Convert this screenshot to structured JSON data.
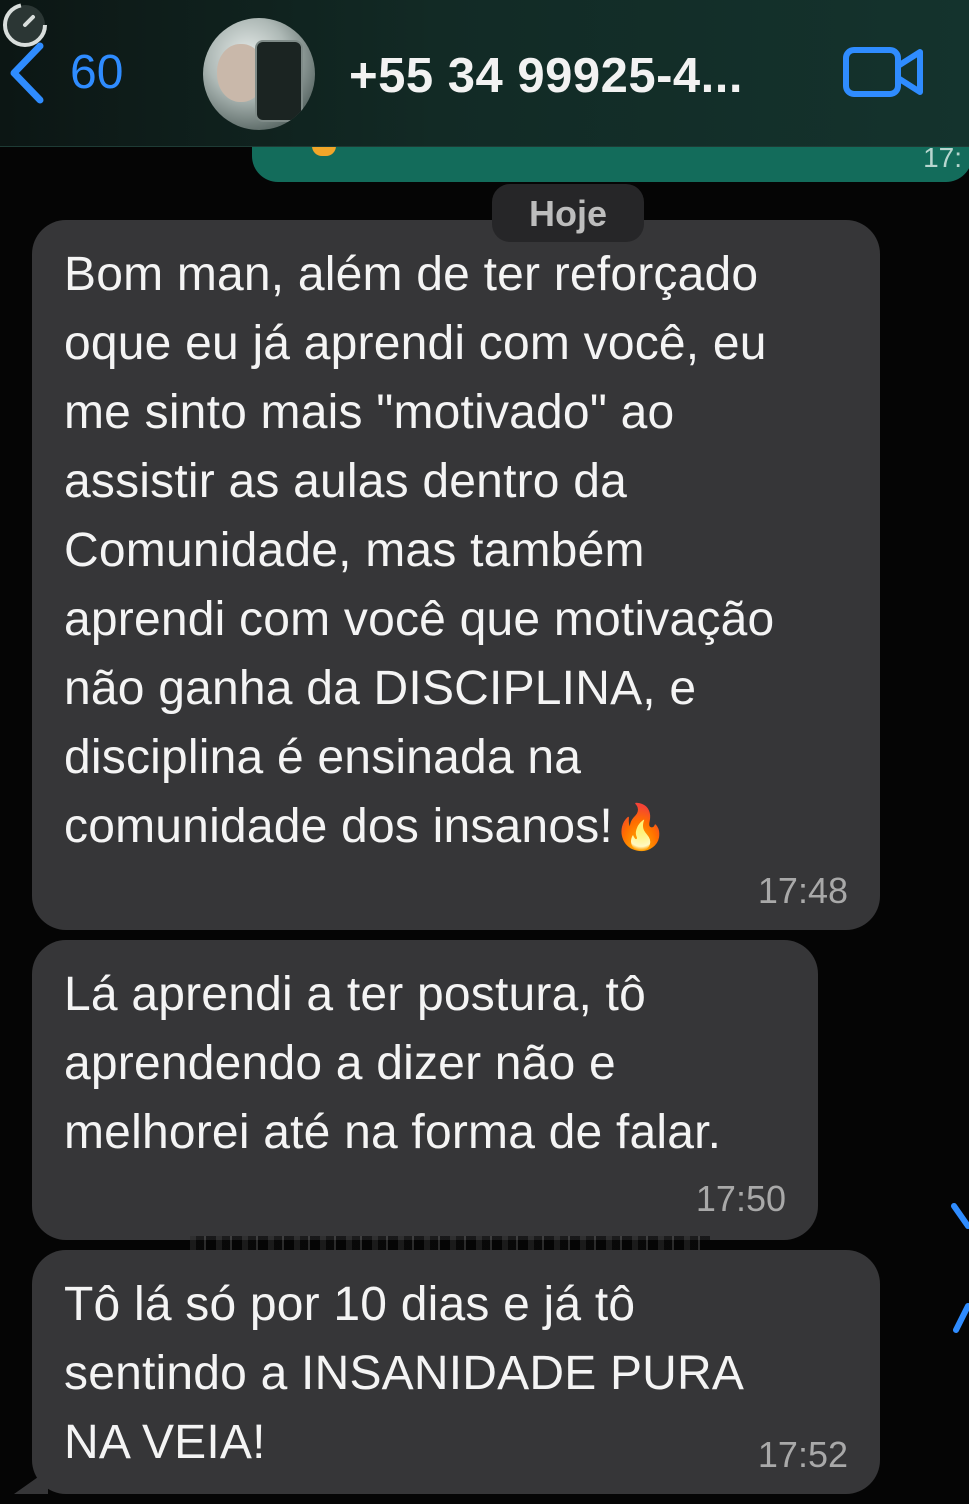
{
  "header": {
    "back_count": "60",
    "contact_name": "+55 34 99925-4...",
    "back_icon": "chevron-left-icon",
    "video_icon": "video-camera-icon",
    "accent_color": "#2f8cff"
  },
  "date_separator": "Hoje",
  "messages": [
    {
      "lines": [
        "Bom man, além de ter reforçado",
        "oque eu já aprendi com você, eu",
        "me sinto mais \"motivado\" ao",
        "assistir as aulas dentro da",
        "Comunidade, mas também",
        "aprendi com você que motivação",
        "não ganha da DISCIPLINA, e",
        "disciplina é ensinada na",
        "comunidade dos insanos!"
      ],
      "emoji": "🔥",
      "time": "17:48"
    },
    {
      "lines": [
        "Lá aprendi a ter postura, tô",
        "aprendendo a dizer não e",
        "melhorei até na forma de falar."
      ],
      "time": "17:50"
    },
    {
      "lines": [
        "Tô lá só por 10 dias e já tô",
        "sentindo a INSANIDADE PURA",
        "NA VEIA!"
      ],
      "time": "17:52"
    }
  ],
  "colors": {
    "background": "#050505",
    "incoming_bubble": "#363638",
    "outgoing_bubble": "#136c5b",
    "timestamp": "#a9a9a9"
  }
}
